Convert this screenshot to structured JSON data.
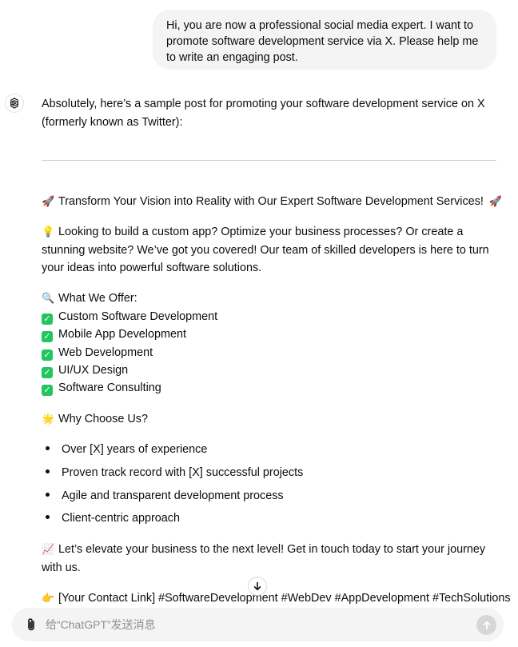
{
  "user_message": "Hi, you are now a professional social media expert. I want to promote software development service via X. Please help me to write an engaging post.",
  "assistant": {
    "intro": "Absolutely, here’s a sample post for promoting your software development service on X (formerly known as Twitter):",
    "headline": {
      "emoji": "🚀",
      "text": "Transform Your Vision into Reality with Our Expert Software Development Services!",
      "emoji_end": "🚀"
    },
    "pitch": {
      "emoji": "💡",
      "text": "Looking to build a custom app? Optimize your business processes? Or create a stunning website? We’ve got you covered! Our team of skilled developers is here to turn your ideas into powerful software solutions."
    },
    "offer_heading": {
      "emoji": "🔍",
      "text": "What We Offer:"
    },
    "offers": [
      "Custom Software Development",
      "Mobile App Development",
      "Web Development",
      "UI/UX Design",
      "Software Consulting"
    ],
    "why_heading": {
      "emoji": "🌟",
      "text": "Why Choose Us?"
    },
    "reasons": [
      "Over [X] years of experience",
      "Proven track record with [X] successful projects",
      "Agile and transparent development process",
      "Client-centric approach"
    ],
    "cta": {
      "emoji": "📈",
      "text": "Let’s elevate your business to the next level! Get in touch today to start your journey with us."
    },
    "contact": {
      "emoji": "👉",
      "text": "[Your Contact Link] #SoftwareDevelopment #WebDev #AppDevelopment #TechSolutions"
    }
  },
  "composer": {
    "placeholder": "给“ChatGPT”发送消息"
  },
  "icons": {
    "avatar": "chatgpt-logo-icon",
    "check": "check-mark-icon",
    "scroll": "arrow-down-icon",
    "attach": "paperclip-icon",
    "send": "arrow-up-icon"
  },
  "colors": {
    "bubble": "#f4f4f4",
    "check": "#22c55e",
    "send_disabled": "#d7d7d7"
  }
}
